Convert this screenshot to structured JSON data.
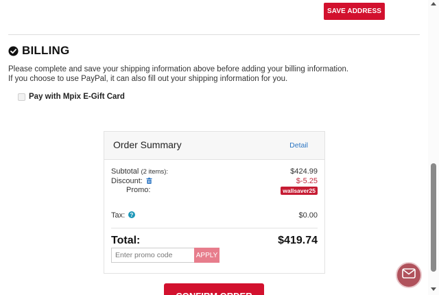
{
  "address": {
    "save_label": "SAVE ADDRESS"
  },
  "billing": {
    "title": "BILLING",
    "message_line1": "Please complete and save your shipping information above before adding your billing information.",
    "message_line2": "If you choose to use PayPal, it can also fill out your shipping information for you.",
    "gift_card_label": "Pay with Mpix E-Gift Card",
    "gift_card_checked": false
  },
  "order_summary": {
    "title": "Order Summary",
    "detail_link": "Detail",
    "subtotal_label": "Subtotal",
    "subtotal_items": "(2 items):",
    "subtotal_value": "$424.99",
    "discount_label": "Discount:",
    "discount_value": "$-5.25",
    "promo_label": "Promo:",
    "promo_code": "wallsaver25",
    "tax_label": "Tax:",
    "tax_value": "$0.00",
    "total_label": "Total:",
    "total_value": "$419.74",
    "promo_placeholder": "Enter promo code",
    "apply_label": "APPLY"
  },
  "confirm": {
    "label": "CONFIRM ORDER"
  },
  "colors": {
    "brand_red": "#d2112e",
    "discount_red": "#c2283c",
    "link_blue": "#2a74c2",
    "apply_pink": "#e77d8c",
    "chat_bg": "#b0525c"
  },
  "icons": {
    "billing_check": "check-circle-icon",
    "discount_remove": "trash-icon",
    "tax_info": "info-icon",
    "chat": "mail-icon"
  }
}
